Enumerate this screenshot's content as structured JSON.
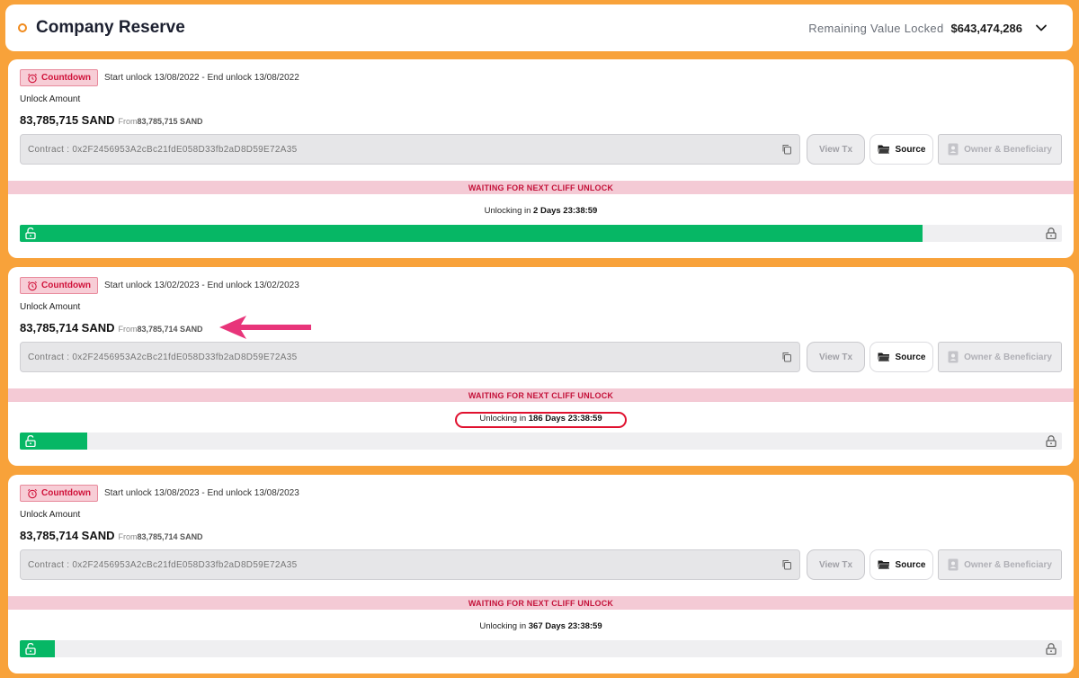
{
  "header": {
    "title": "Company Reserve",
    "remaining_label": "Remaining Value Locked",
    "remaining_value": "$643,474,286"
  },
  "common": {
    "badge": "Countdown",
    "unlock_amount_label": "Unlock Amount",
    "from_label": "From",
    "view_tx": "View Tx",
    "source": "Source",
    "owner": "Owner & Beneficiary",
    "waiting": "WAITING FOR NEXT CLIFF UNLOCK",
    "unlocking_prefix": "Unlocking in"
  },
  "cards": [
    {
      "dates": "Start unlock 13/08/2022 - End unlock 13/08/2022",
      "amount": "83,785,715 SAND",
      "from_amount": "83,785,715 SAND",
      "contract": "Contract : 0x2F2456953A2cBc21fdE058D33fb2aD8D59E72A35",
      "countdown": "2 Days 23:38:59",
      "progress": 0.866
    },
    {
      "dates": "Start unlock 13/02/2023 - End unlock 13/02/2023",
      "amount": "83,785,714 SAND",
      "from_amount": "83,785,714 SAND",
      "contract": "Contract : 0x2F2456953A2cBc21fdE058D33fb2aD8D59E72A35",
      "countdown": "186 Days 23:38:59",
      "progress": 0.065
    },
    {
      "dates": "Start unlock 13/08/2023 - End unlock 13/08/2023",
      "amount": "83,785,714 SAND",
      "from_amount": "83,785,714 SAND",
      "contract": "Contract : 0x2F2456953A2cBc21fdE058D33fb2aD8D59E72A35",
      "countdown": "367 Days 23:38:59",
      "progress": 0.034
    }
  ],
  "colors": {
    "accent": "#f8a23a",
    "progress_fill": "#06b765",
    "alert": "#c4123a",
    "annotation": "#e8357a"
  }
}
